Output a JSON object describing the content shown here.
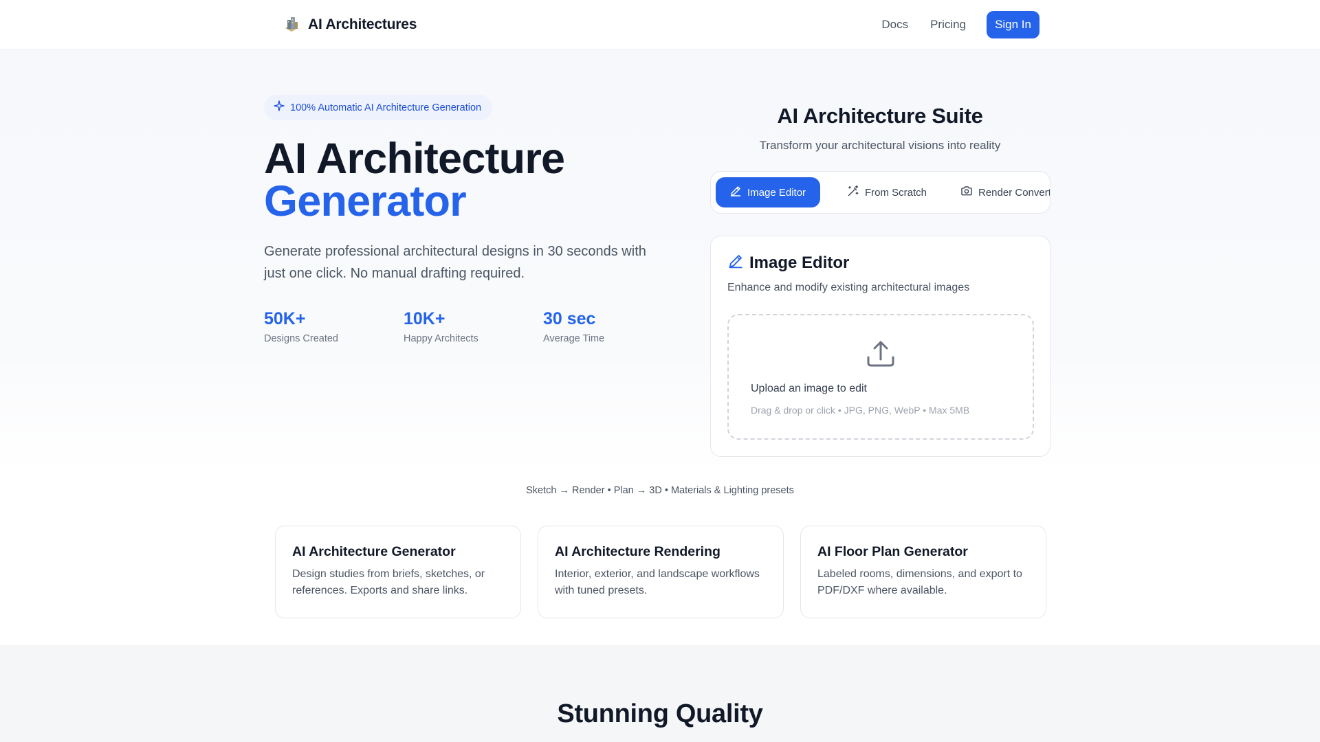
{
  "header": {
    "brand": "AI Architectures",
    "nav": [
      "Docs",
      "Pricing"
    ],
    "signin_label": "Sign In"
  },
  "hero": {
    "badge": "100% Automatic AI Architecture Generation",
    "title_line1": "AI Architecture",
    "title_line2": "Generator",
    "subtitle": "Generate professional architectural designs in 30 seconds with just one click. No manual drafting required.",
    "stats": [
      {
        "value": "50K+",
        "label": "Designs Created"
      },
      {
        "value": "10K+",
        "label": "Happy Architects"
      },
      {
        "value": "30 sec",
        "label": "Average Time"
      }
    ]
  },
  "suite": {
    "title": "AI Architecture Suite",
    "subtitle": "Transform your architectural visions into reality",
    "tabs": [
      {
        "label": "Image Editor",
        "icon": "pencil-icon",
        "active": true
      },
      {
        "label": "From Scratch",
        "icon": "magic-wand-icon",
        "active": false
      },
      {
        "label": "Render Converter",
        "icon": "camera-icon",
        "active": false
      }
    ],
    "panel": {
      "title": "Image Editor",
      "description": "Enhance and modify existing architectural images",
      "upload_title": "Upload an image to edit",
      "upload_hint": "Drag & drop or click • JPG, PNG, WebP • Max 5MB"
    }
  },
  "tagline": "Sketch → Render • Plan → 3D • Materials & Lighting presets",
  "features": [
    {
      "title": "AI Architecture Generator",
      "description": "Design studies from briefs, sketches, or references. Exports and share links."
    },
    {
      "title": "AI Architecture Rendering",
      "description": "Interior, exterior, and landscape workflows with tuned presets."
    },
    {
      "title": "AI Floor Plan Generator",
      "description": "Labeled rooms, dimensions, and export to PDF/DXF where available."
    }
  ],
  "quality": {
    "title": "Stunning Quality"
  },
  "colors": {
    "accent": "#2563eb",
    "text": "#111827",
    "muted": "#4b5563"
  }
}
